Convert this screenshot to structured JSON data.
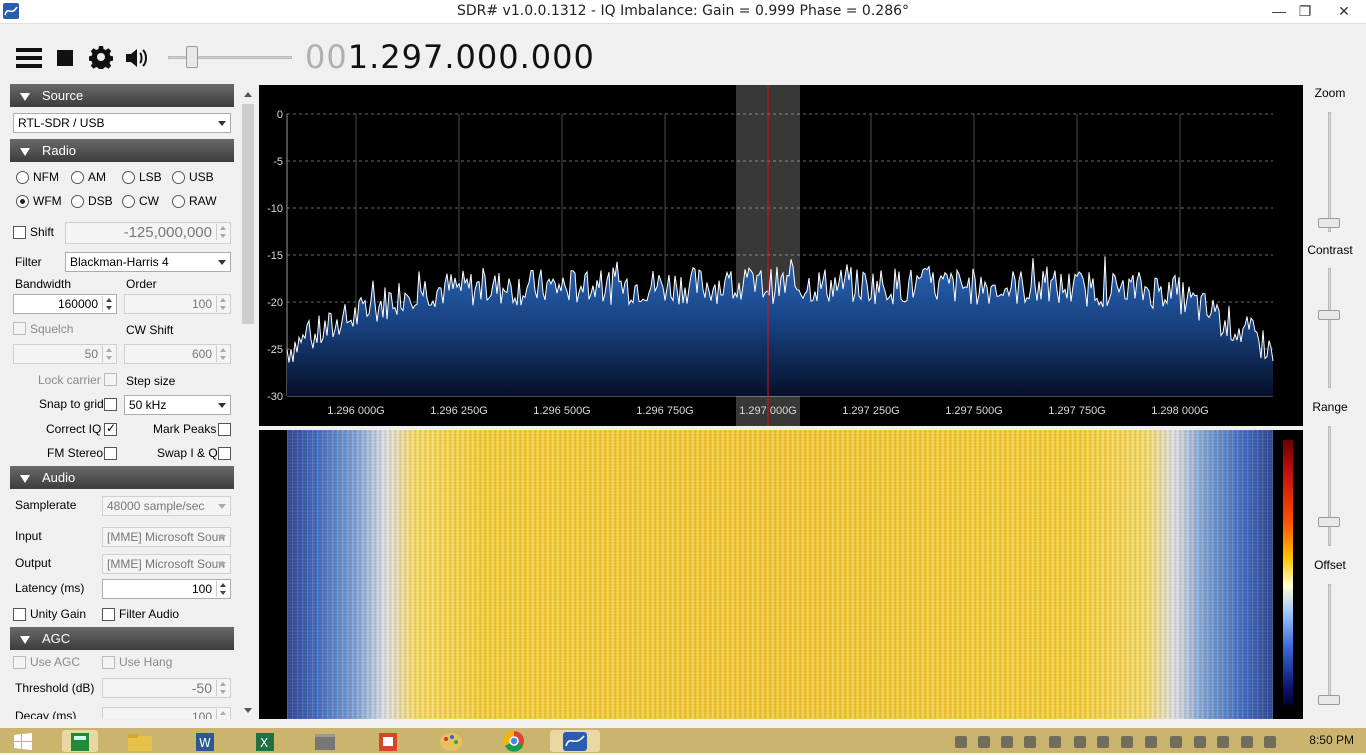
{
  "window": {
    "title": "SDR# v1.0.0.1312 - IQ Imbalance: Gain = 0.999 Phase = 0.286°",
    "min": "—",
    "max": "❐",
    "close": "✕"
  },
  "toolbar": {
    "frequency_dim": "00",
    "frequency_main": "1.297.000.000",
    "volume": 0.2
  },
  "source": {
    "header": "Source",
    "device": "RTL-SDR / USB"
  },
  "radio": {
    "header": "Radio",
    "modes": [
      "NFM",
      "AM",
      "LSB",
      "USB",
      "WFM",
      "DSB",
      "CW",
      "RAW"
    ],
    "selected_mode": "WFM",
    "shift_label": "Shift",
    "shift_value": "-125,000,000",
    "filter_label": "Filter",
    "filter_value": "Blackman-Harris 4",
    "bandwidth_label": "Bandwidth",
    "bandwidth_value": "160000",
    "order_label": "Order",
    "order_value": "100",
    "squelch_label": "Squelch",
    "squelch_value": "50",
    "cwshift_label": "CW Shift",
    "cwshift_value": "600",
    "lock_carrier_label": "Lock carrier",
    "step_size_label": "Step size",
    "snap_label": "Snap to grid",
    "step_value": "50 kHz",
    "correct_iq_label": "Correct IQ",
    "mark_peaks_label": "Mark Peaks",
    "fm_stereo_label": "FM Stereo",
    "swap_iq_label": "Swap I & Q"
  },
  "audio": {
    "header": "Audio",
    "samplerate_label": "Samplerate",
    "samplerate_value": "48000 sample/sec",
    "input_label": "Input",
    "input_value": "[MME] Microsoft Soun",
    "output_label": "Output",
    "output_value": "[MME] Microsoft Soun",
    "latency_label": "Latency (ms)",
    "latency_value": "100",
    "unity_gain_label": "Unity Gain",
    "filter_audio_label": "Filter Audio"
  },
  "agc": {
    "header": "AGC",
    "use_agc_label": "Use AGC",
    "use_hang_label": "Use Hang",
    "threshold_label": "Threshold (dB)",
    "threshold_value": "-50",
    "decay_label": "Decay (ms)",
    "decay_value": "100"
  },
  "right": {
    "zoom_label": "Zoom",
    "contrast_label": "Contrast",
    "range_label": "Range",
    "offset_label": "Offset"
  },
  "spectrum": {
    "y_ticks": [
      "0",
      "-5",
      "-10",
      "-15",
      "-20",
      "-25",
      "-30"
    ],
    "x_ticks": [
      "1.296 000G",
      "1.296 250G",
      "1.296 500G",
      "1.296 750G",
      "1.297 000G",
      "1.297 250G",
      "1.297 500G",
      "1.297 750G",
      "1.298 000G"
    ],
    "colors": {
      "trace": "#ffffff",
      "fill_top": "#1e5aa8",
      "fill_bottom": "#08122e",
      "center_line": "#e01010"
    }
  },
  "taskbar": {
    "clock": "8:50 PM"
  }
}
